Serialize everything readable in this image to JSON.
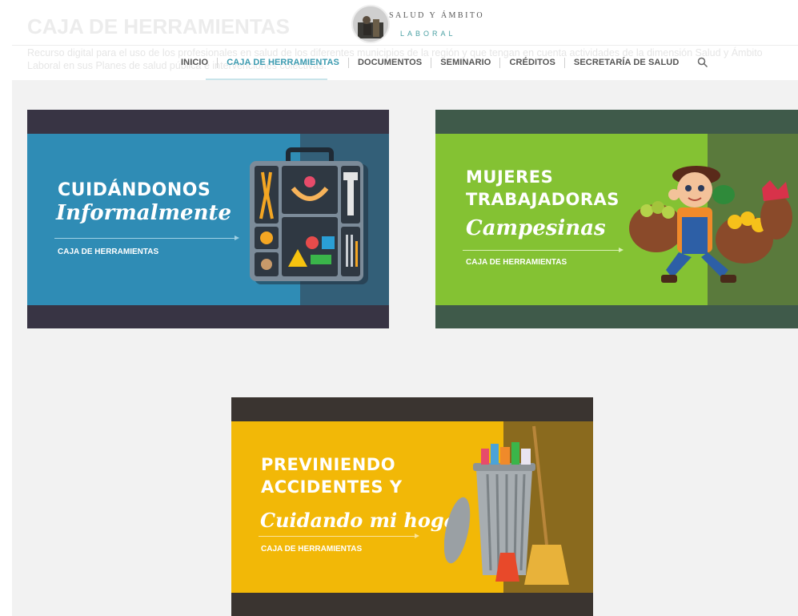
{
  "background_header": {
    "title": "CAJA DE HERRAMIENTAS",
    "description": "Recurso digital para el uso de los profesionales en salud de los diferentes municipios de la región y que tengan en cuenta actividades de la dimensión Salud y Ámbito Laboral en sus Planes de salud pública e intervenciones colectivas."
  },
  "logo": {
    "line1": "SALUD Y ÁMBITO",
    "line2": "LABORAL"
  },
  "nav": {
    "items": [
      {
        "label": "INICIO"
      },
      {
        "label": "CAJA DE HERRAMIENTAS"
      },
      {
        "label": "DOCUMENTOS"
      },
      {
        "label": "SEMINARIO"
      },
      {
        "label": "CRÉDITOS"
      },
      {
        "label": "SECRETARÍA DE SALUD"
      }
    ],
    "active_index": 1,
    "search_icon": "search-icon"
  },
  "cards": [
    {
      "line1": "CUIDÁNDONOS",
      "script": "Informalmente",
      "subtitle": "CAJA DE HERRAMIENTAS",
      "colors": {
        "band": "#383444",
        "main": "#2f8cb5",
        "right": "#335f78"
      },
      "illustration": "toolbox-icon"
    },
    {
      "line1": "MUJERES",
      "line2": "TRABAJADORAS",
      "script": "Campesinas",
      "subtitle": "CAJA DE HERRAMIENTAS",
      "colors": {
        "band": "#3f5a4a",
        "main": "#84c233",
        "right": "#5a7a3c"
      },
      "illustration": "farmer-girl-icon"
    },
    {
      "line1": "PREVINIENDO",
      "line2": "ACCIDENTES Y",
      "script": "Cuidando mi hogar",
      "subtitle": "CAJA DE HERRAMIENTAS",
      "colors": {
        "band": "#3a3430",
        "main": "#f2b807",
        "right": "#8a6a1e"
      },
      "illustration": "trash-can-broom-icon"
    }
  ]
}
